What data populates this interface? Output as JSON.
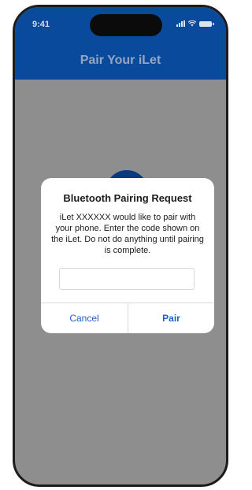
{
  "status_bar": {
    "time": "9:41"
  },
  "header": {
    "title": "Pair Your iLet"
  },
  "dialog": {
    "title": "Bluetooth Pairing Request",
    "message": "iLet XXXXXX would like to pair with your phone. Enter the code shown on the iLet. Do not do anything until pairing is complete.",
    "input_value": "",
    "cancel_label": "Cancel",
    "pair_label": "Pair"
  },
  "colors": {
    "header": "#0a4a9c",
    "overlay": "#8e8e8e",
    "accent": "#1f5fc4"
  }
}
